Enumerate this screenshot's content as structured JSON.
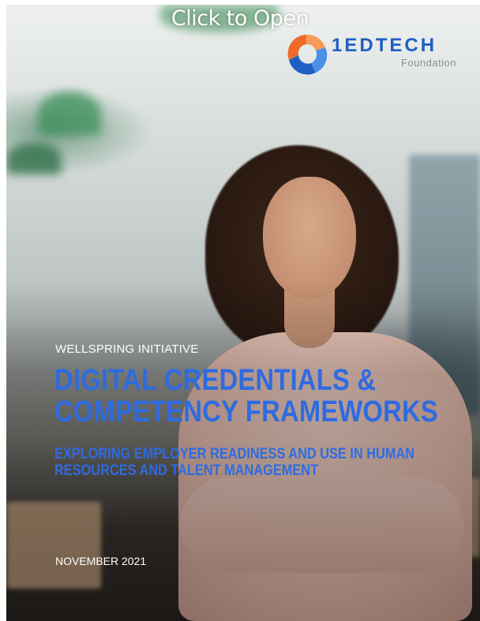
{
  "overlay": {
    "click_label": "Click to Open"
  },
  "logo": {
    "word": "1EDTECH",
    "sub": "Foundation"
  },
  "cover": {
    "eyebrow": "WELLSPRING INITIATIVE",
    "title_line1": "DIGITAL CREDENTIALS &",
    "title_line2": "COMPETENCY FRAMEWORKS",
    "subtitle_line1": "EXPLORING EMPLOYER READINESS AND USE IN HUMAN",
    "subtitle_line2": "RESOURCES AND TALENT MANAGEMENT",
    "date": "NOVEMBER 2021"
  },
  "colors": {
    "accent": "#2f6be0",
    "logo_blue": "#1f5fc4",
    "logo_orange": "#f06a2a"
  }
}
